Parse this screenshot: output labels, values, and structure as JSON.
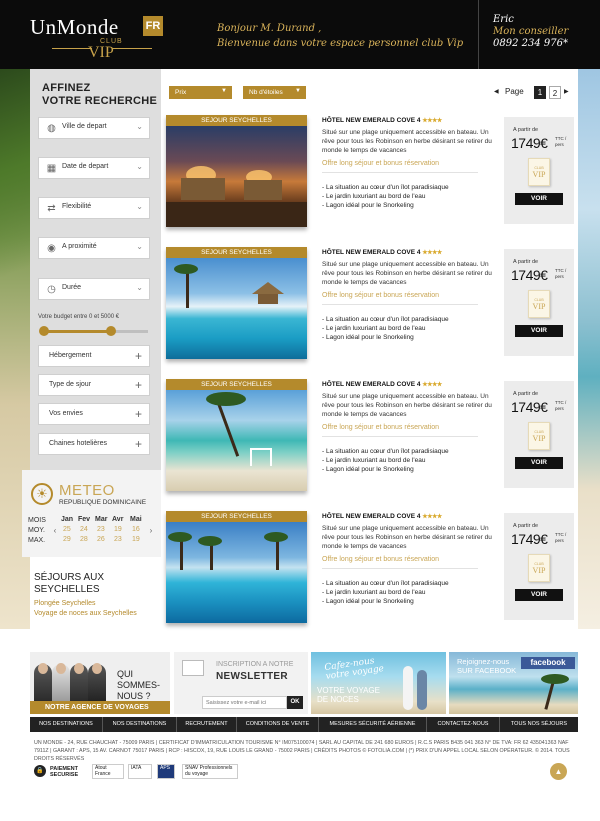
{
  "header": {
    "logo_main": "UnMonde",
    "logo_flag": "FR",
    "logo_club": "CLUB",
    "logo_vip": "VIP",
    "greeting_line1": "Bonjour M. Durand ,",
    "greeting_line2": "Bienvenue dans votre espace personnel club Vip",
    "advisor_name": "Eric",
    "advisor_role": "Mon conseiller",
    "advisor_phone": "0892 234 976*"
  },
  "sidebar": {
    "title_line1": "AFFINEZ",
    "title_line2": "VOTRE RECHERCHE",
    "fields": [
      {
        "label": "Ville de depart",
        "icon": "globe-icon"
      },
      {
        "label": "Date de depart",
        "icon": "calendar-icon"
      },
      {
        "label": "Flexibilité",
        "icon": "flexibility-icon"
      },
      {
        "label": "A proximité",
        "icon": "location-icon"
      },
      {
        "label": "Durée",
        "icon": "clock-icon"
      }
    ],
    "budget_label": "Votre budget entre 0 et 5000 €",
    "budget_min": 0,
    "budget_max": 5000,
    "accordions": [
      "Hébergement",
      "Type de sjour",
      "Vos envies",
      "Chaines hotelières"
    ]
  },
  "meteo": {
    "title": "METEO",
    "country": "REPUBLIQUE DOMINICAINE",
    "row_labels": [
      "MOIS",
      "MOY.",
      "MAX."
    ],
    "months": [
      "Jan",
      "Fev",
      "Mar",
      "Avr",
      "Mai"
    ],
    "moy": [
      "25",
      "24",
      "23",
      "19",
      "16"
    ],
    "max": [
      "29",
      "28",
      "26",
      "23",
      "19"
    ]
  },
  "sejours": {
    "title_line1": "SÉJOURS AUX",
    "title_line2": "SEYCHELLES",
    "links": [
      "Plongée Seychelles",
      "Voyage de noces aux Seychelles"
    ]
  },
  "toolbar": {
    "sort_price": "Prix",
    "sort_stars": "Nb d'étoiles",
    "page_label": "Page",
    "pages": [
      "1",
      "2"
    ]
  },
  "listings": [
    {
      "tag": "SEJOUR SEYCHELLES",
      "name": "HÔTEL NEW EMERALD COVE 4",
      "stars": "★★★★",
      "desc": "Situé sur une plage uniquement accessible en bateau. Un rêve pour tous les Robinson en herbe désirant se retirer du monde le temps de vacances",
      "offer": "Offre long séjour et bonus réservation",
      "features": [
        "- La situation au cœur d'un îlot paradisiaque",
        "- Le jardin luxuriant au bord de l'eau",
        "- Lagon idéal pour le Snorkeling"
      ],
      "from": "A partir de",
      "price": "1749€",
      "ttc": "TTC / pers",
      "vip_club": "CLUB",
      "vip": "VIP",
      "cta": "VOIR"
    },
    {
      "tag": "SEJOUR SEYCHELLES",
      "name": "HÔTEL NEW EMERALD COVE 4",
      "stars": "★★★★",
      "desc": "Situé sur une plage uniquement accessible en bateau. Un rêve pour tous les Robinson en herbe désirant se retirer du monde le temps de vacances",
      "offer": "Offre long séjour et bonus réservation",
      "features": [
        "- La situation au cœur d'un îlot paradisiaque",
        "- Le jardin luxuriant au bord de l'eau",
        "- Lagon idéal pour le Snorkeling"
      ],
      "from": "A partir de",
      "price": "1749€",
      "ttc": "TTC / pers",
      "vip_club": "CLUB",
      "vip": "VIP",
      "cta": "VOIR"
    },
    {
      "tag": "SEJOUR SEYCHELLES",
      "name": "HÔTEL NEW EMERALD COVE 4",
      "stars": "★★★★",
      "desc": "Situé sur une plage uniquement accessible en bateau. Un rêve pour tous les Robinson en herbe désirant se retirer du monde le temps de vacances",
      "offer": "Offre long séjour et bonus réservation",
      "features": [
        "- La situation au cœur d'un îlot paradisiaque",
        "- Le jardin luxuriant au bord de l'eau",
        "- Lagon idéal pour le Snorkeling"
      ],
      "from": "A partir de",
      "price": "1749€",
      "ttc": "TTC / pers",
      "vip_club": "CLUB",
      "vip": "VIP",
      "cta": "VOIR"
    },
    {
      "tag": "SEJOUR SEYCHELLES",
      "name": "HÔTEL NEW EMERALD COVE 4",
      "stars": "★★★★",
      "desc": "Situé sur une plage uniquement accessible en bateau. Un rêve pour tous les Robinson en herbe désirant se retirer du monde le temps de vacances",
      "offer": "Offre long séjour et bonus réservation",
      "features": [
        "- La situation au cœur d'un îlot paradisiaque",
        "- Le jardin luxuriant au bord de l'eau",
        "- Lagon idéal pour le Snorkeling"
      ],
      "from": "A partir de",
      "price": "1749€",
      "ttc": "TTC / pers",
      "vip_club": "CLUB",
      "vip": "VIP",
      "cta": "VOIR"
    }
  ],
  "promos": {
    "team_line1": "QUI",
    "team_line2": "SOMMES-NOUS ?",
    "team_bar": "NOTRE AGENCE DE VOYAGES",
    "newsletter_sub": "INSCRIPTION A NOTRE",
    "newsletter_title": "NEWSLETTER",
    "newsletter_placeholder": "Saisissez votre e-mail ici",
    "newsletter_ok": "OK",
    "cafe_line1": "Cafez-nous",
    "cafe_line2": "votre voyage",
    "cafe_text1": "VOTRE VOYAGE",
    "cafe_text2": "DE NOCES",
    "join_line1": "Rejoignez-nous",
    "join_line2": "SUR FACEBOOK",
    "facebook": "facebook"
  },
  "footer_nav": [
    "NOS DESTINATIONS",
    "NOS DESTINATIONS",
    "RECRUTEMENT",
    "CONDITIONS DE VENTE",
    "MESURES SÉCURITÉ AÉRIENNE",
    "CONTACTEZ-NOUS",
    "TOUS NOS SÉJOURS"
  ],
  "legal": "UN MONDE - 24, RUE CHAUCHAT - 75009 PARIS | CERTIFICAT D'IMMATRICULATION TOURISME N° IM075100074 | SARL AU CAPITAL DE 241 680 EUROS | R.C.S PARIS B435 041 363 N° DE TVA: FR 62 435041363 NAF 7911Z | GARANT : APS, 15 AV. CARNOT 75017 PARIS | RCP : HISCOX, 19, RUE LOUIS LE GRAND - 75002 PARIS | CRÉDITS PHOTOS © FOTOLIA.COM | (*) PRIX D'UN APPEL LOCAL SELON OPÉRATEUR. © 2014. TOUS DROITS RÉSERVÉS",
  "badges": {
    "pay_line1": "PAIEMENT",
    "pay_line2": "SECURISE",
    "badge2": "Atout France",
    "badge3": "IATA",
    "badge4": "APS",
    "badge5": "SNAV Professionnels du voyage"
  },
  "colors": {
    "accent": "#b48a2c",
    "dark": "#0b0b0b"
  }
}
